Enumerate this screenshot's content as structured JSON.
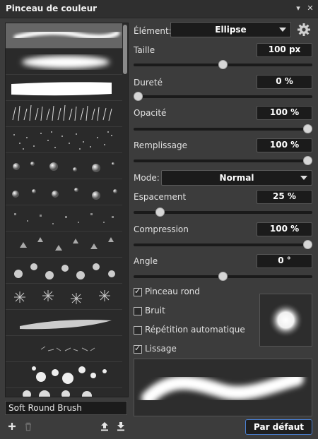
{
  "window": {
    "title": "Pinceau de couleur"
  },
  "brush_list": {
    "selected_name": "Soft Round Brush"
  },
  "element": {
    "label": "Élément:",
    "value": "Ellipse"
  },
  "size": {
    "label": "Taille",
    "value": "100 px",
    "slider_fraction": 0.5
  },
  "hardness": {
    "label": "Dureté",
    "value": "0  %",
    "slider_fraction": 0.0
  },
  "opacity": {
    "label": "Opacité",
    "value": "100  %",
    "slider_fraction": 1.0
  },
  "fill": {
    "label": "Remplissage",
    "value": "100  %",
    "slider_fraction": 1.0
  },
  "mode": {
    "label": "Mode:",
    "value": "Normal"
  },
  "spacing": {
    "label": "Espacement",
    "value": "25  %",
    "slider_fraction": 0.13
  },
  "compression": {
    "label": "Compression",
    "value": "100  %",
    "slider_fraction": 1.0
  },
  "angle": {
    "label": "Angle",
    "value": "0  °",
    "slider_fraction": 0.5
  },
  "checkboxes": {
    "round": {
      "label": "Pinceau rond",
      "checked": true
    },
    "noise": {
      "label": "Bruit",
      "checked": false
    },
    "repeat": {
      "label": "Répétition automatique",
      "checked": false
    },
    "smooth": {
      "label": "Lissage",
      "checked": true
    }
  },
  "buttons": {
    "default_label": "Par défaut"
  },
  "icons": {
    "add": "plus-icon",
    "delete": "trash-icon",
    "import": "import-icon",
    "export": "export-icon",
    "settings": "gear-icon",
    "menu": "chevron-down-icon",
    "close": "close-icon"
  },
  "colors": {
    "accent": "#4a7fd1",
    "panel": "#3c3c3c"
  }
}
